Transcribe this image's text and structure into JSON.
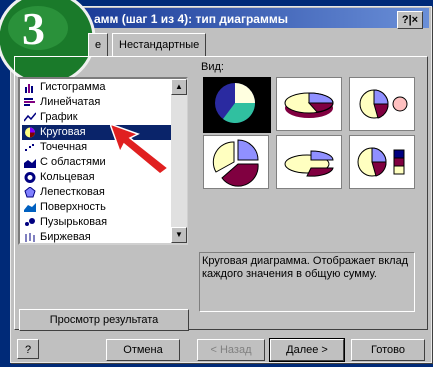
{
  "badge_number": "3",
  "window": {
    "title": "амм (шаг 1 из 4): тип диаграммы",
    "help_button": "?|×"
  },
  "tabs": [
    {
      "label": "е"
    },
    {
      "label": "Нестандартные"
    }
  ],
  "chart_list": {
    "items": [
      {
        "label": "Гистограмма",
        "icon": "bar-chart-icon"
      },
      {
        "label": "Линейчатая",
        "icon": "horizontal-bar-icon"
      },
      {
        "label": "График",
        "icon": "line-chart-icon"
      },
      {
        "label": "Круговая",
        "icon": "pie-chart-icon",
        "selected": true
      },
      {
        "label": "Точечная",
        "icon": "scatter-icon"
      },
      {
        "label": "С областями",
        "icon": "area-chart-icon"
      },
      {
        "label": "Кольцевая",
        "icon": "doughnut-icon"
      },
      {
        "label": "Лепестковая",
        "icon": "radar-icon"
      },
      {
        "label": "Поверхность",
        "icon": "surface-icon"
      },
      {
        "label": "Пузырьковая",
        "icon": "bubble-icon"
      },
      {
        "label": "Биржевая",
        "icon": "stock-icon"
      }
    ]
  },
  "subtype": {
    "label": "Вид:",
    "thumbnails": 6
  },
  "description": "Круговая диаграмма. Отображает вклад каждого значения в общую сумму.",
  "preview_button": "Просмотр результата",
  "footer": {
    "help_icon": "?",
    "cancel": "Отмена",
    "back": "< Назад",
    "next": "Далее >",
    "finish": "Готово"
  },
  "colors": {
    "title_bar": "#0a2a8a",
    "background": "#002a78",
    "selection": "#0a246a",
    "badge": "#1a7a2a",
    "arrow": "#e02020"
  }
}
